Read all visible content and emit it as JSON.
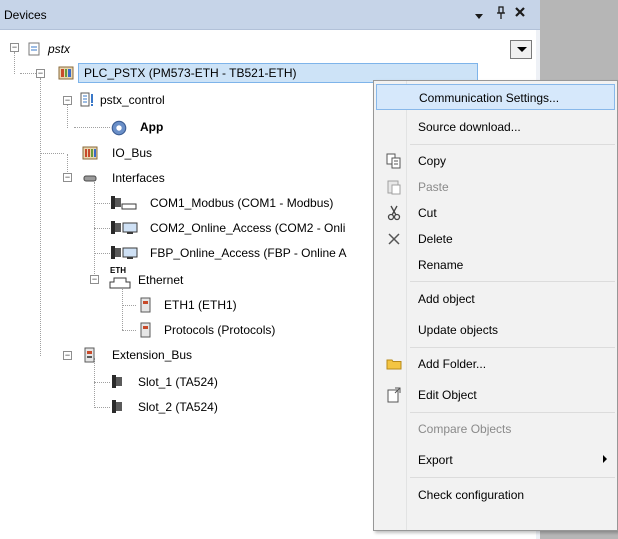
{
  "panel": {
    "title": "Devices",
    "pin_glyph": "ᵖ",
    "close_glyph": "✕",
    "dropdown_glyph": "▾"
  },
  "tree": {
    "root": "pstx",
    "plc": "PLC_PSTX (PM573-ETH - TB521-ETH)",
    "pstx_control": "pstx_control",
    "app": "App",
    "io_bus": "IO_Bus",
    "interfaces": "Interfaces",
    "com1": "COM1_Modbus (COM1 - Modbus)",
    "com2": "COM2_Online_Access (COM2 - Onli",
    "fbp": "FBP_Online_Access (FBP - Online A",
    "ethernet": "Ethernet",
    "eth_label": "ETH",
    "eth1": "ETH1 (ETH1)",
    "protocols": "Protocols (Protocols)",
    "extension_bus": "Extension_Bus",
    "slot1": "Slot_1 (TA524)",
    "slot2": "Slot_2 (TA524)"
  },
  "context_menu": {
    "items": [
      {
        "label": "Communication Settings..."
      },
      {
        "label": "Source download..."
      },
      {
        "label": "Copy"
      },
      {
        "label": "Paste"
      },
      {
        "label": "Cut"
      },
      {
        "label": "Delete"
      },
      {
        "label": "Rename"
      },
      {
        "label": "Add object"
      },
      {
        "label": "Update objects"
      },
      {
        "label": "Add Folder..."
      },
      {
        "label": "Edit Object"
      },
      {
        "label": "Compare Objects"
      },
      {
        "label": "Export"
      },
      {
        "label": "Check configuration"
      }
    ]
  }
}
